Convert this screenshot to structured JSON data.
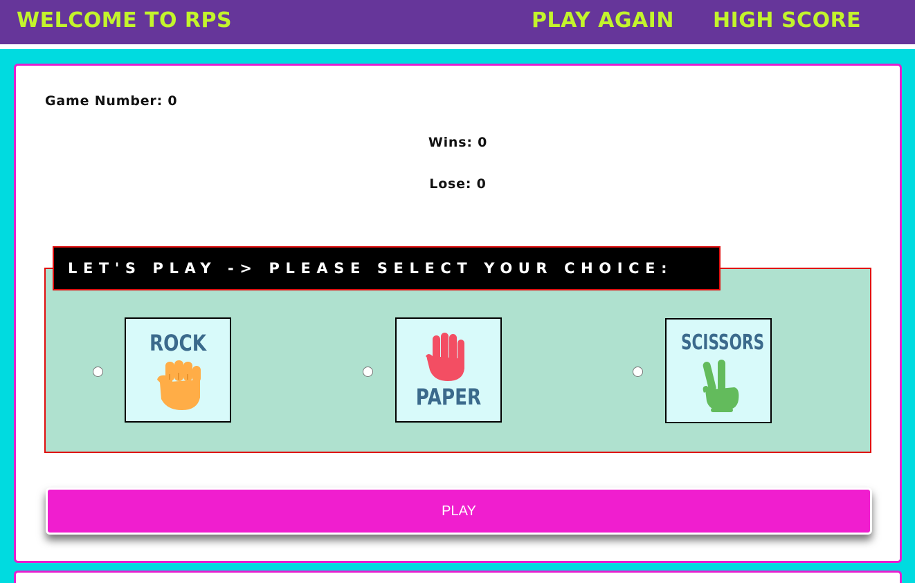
{
  "navbar": {
    "brand": "WELCOME TO RPS",
    "play_again": "PLAY AGAIN",
    "high_score": "HIGH SCORE"
  },
  "stats": {
    "game_number": "Game Number: 0",
    "wins": "Wins: 0",
    "lose": "Lose: 0"
  },
  "choices": {
    "legend": "LET'S PLAY -> PLEASE SELECT YOUR CHOICE:",
    "options": [
      {
        "label": "ROCK",
        "icon": "fist-icon"
      },
      {
        "label": "PAPER",
        "icon": "open-hand-icon"
      },
      {
        "label": "SCISSORS",
        "icon": "two-fingers-icon"
      }
    ]
  },
  "play_button": "PLAY",
  "colors": {
    "nav_bg": "#66369a",
    "nav_text": "#c3f42c",
    "page_bg": "#00dbe0",
    "card_border": "#e61ecf",
    "choice_bg": "#afe1cf",
    "play_button_bg": "#f01ecf"
  }
}
